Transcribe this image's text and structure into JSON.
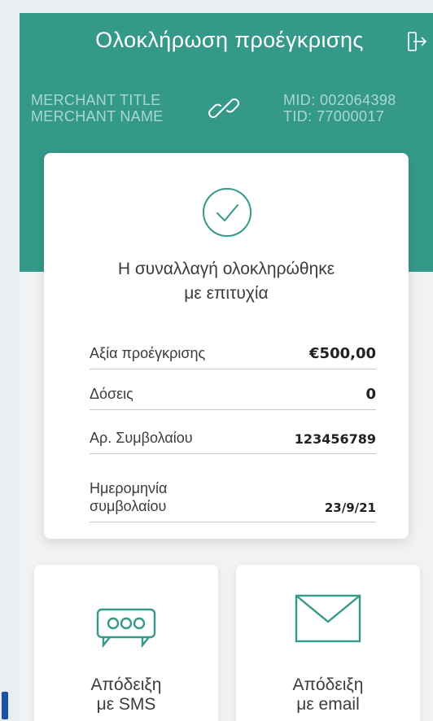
{
  "header": {
    "title": "Ολοκλήρωση προέγκρισης",
    "icons": {
      "logout": "logout-icon",
      "link": "link-icon"
    }
  },
  "merchant": {
    "title": "MERCHANT TITLE",
    "name": "MERCHANT NAME",
    "mid": "MID: 002064398",
    "tid": "TID: 77000017"
  },
  "result": {
    "icon": "check-circle-icon",
    "message_line1": "Η συναλλαγή ολοκληρώθηκε",
    "message_line2": "με επιτυχία"
  },
  "details": [
    {
      "label": "Αξία προέγκρισης",
      "value": "€500,00"
    },
    {
      "label": "Δόσεις",
      "value": "0"
    },
    {
      "label": "Αρ. Συμβολαίου",
      "value": "123456789"
    },
    {
      "label_line1": "Ημερομηνία",
      "label_line2": "συμβολαίου",
      "value": "23/9/21"
    }
  ],
  "receipts": {
    "sms": {
      "line1": "Απόδειξη",
      "line2": "με SMS",
      "icon": "sms-icon"
    },
    "email": {
      "line1": "Απόδειξη",
      "line2": "με email",
      "icon": "envelope-icon"
    }
  },
  "colors": {
    "header_bg": "#35998a",
    "accent": "#35998a",
    "merchant_text": "#a8d8cf"
  }
}
